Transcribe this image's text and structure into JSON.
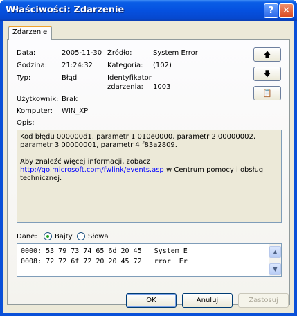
{
  "window": {
    "title": "Właściwości: Zdarzenie",
    "help_glyph": "?",
    "close_glyph": "✕"
  },
  "tab": {
    "label": "Zdarzenie"
  },
  "fields": {
    "date_label": "Data:",
    "date_value": "2005-11-30",
    "source_label": "Źródło:",
    "source_value": "System Error",
    "time_label": "Godzina:",
    "time_value": "21:24:32",
    "category_label": "Kategoria:",
    "category_value": "(102)",
    "type_label": "Typ:",
    "type_value": "Błąd",
    "event_id_label_line1": "Identyfikator",
    "event_id_label_line2": "zdarzenia:",
    "event_id_value": "1003",
    "user_label": "Użytkownik:",
    "user_value": "Brak",
    "computer_label": "Komputer:",
    "computer_value": "WIN_XP"
  },
  "nav_buttons": {
    "up_glyph": "🡅",
    "down_glyph": "🡇",
    "copy_glyph": "📋"
  },
  "description": {
    "label": "Opis:",
    "para1": "Kod błędu 000000d1, parametr 1 010e0000, parametr 2 00000002, parametr 3 00000001, parametr 4 f83a2809.",
    "para2_text": "Aby znaleźć więcej informacji, zobacz",
    "para2_link": "http://go.microsoft.com/fwlink/events.asp",
    "para2_suffix": " w Centrum pomocy i obsługi technicznej."
  },
  "data_section": {
    "label": "Dane:",
    "option_bytes": "Bajty",
    "option_words": "Słowa",
    "selected": "Bajty",
    "lines": [
      "0000: 53 79 73 74 65 6d 20 45   System E",
      "0008: 72 72 6f 72 20 20 45 72   rror  Er"
    ],
    "scroll_up_glyph": "▲",
    "scroll_down_glyph": "▼"
  },
  "buttons": {
    "ok": "OK",
    "cancel": "Anuluj",
    "apply": "Zastosuj"
  },
  "colors": {
    "title_bar": "#0551e0",
    "face": "#ece9d8",
    "tab_accent": "#f0a22c",
    "link": "#0000ff"
  }
}
